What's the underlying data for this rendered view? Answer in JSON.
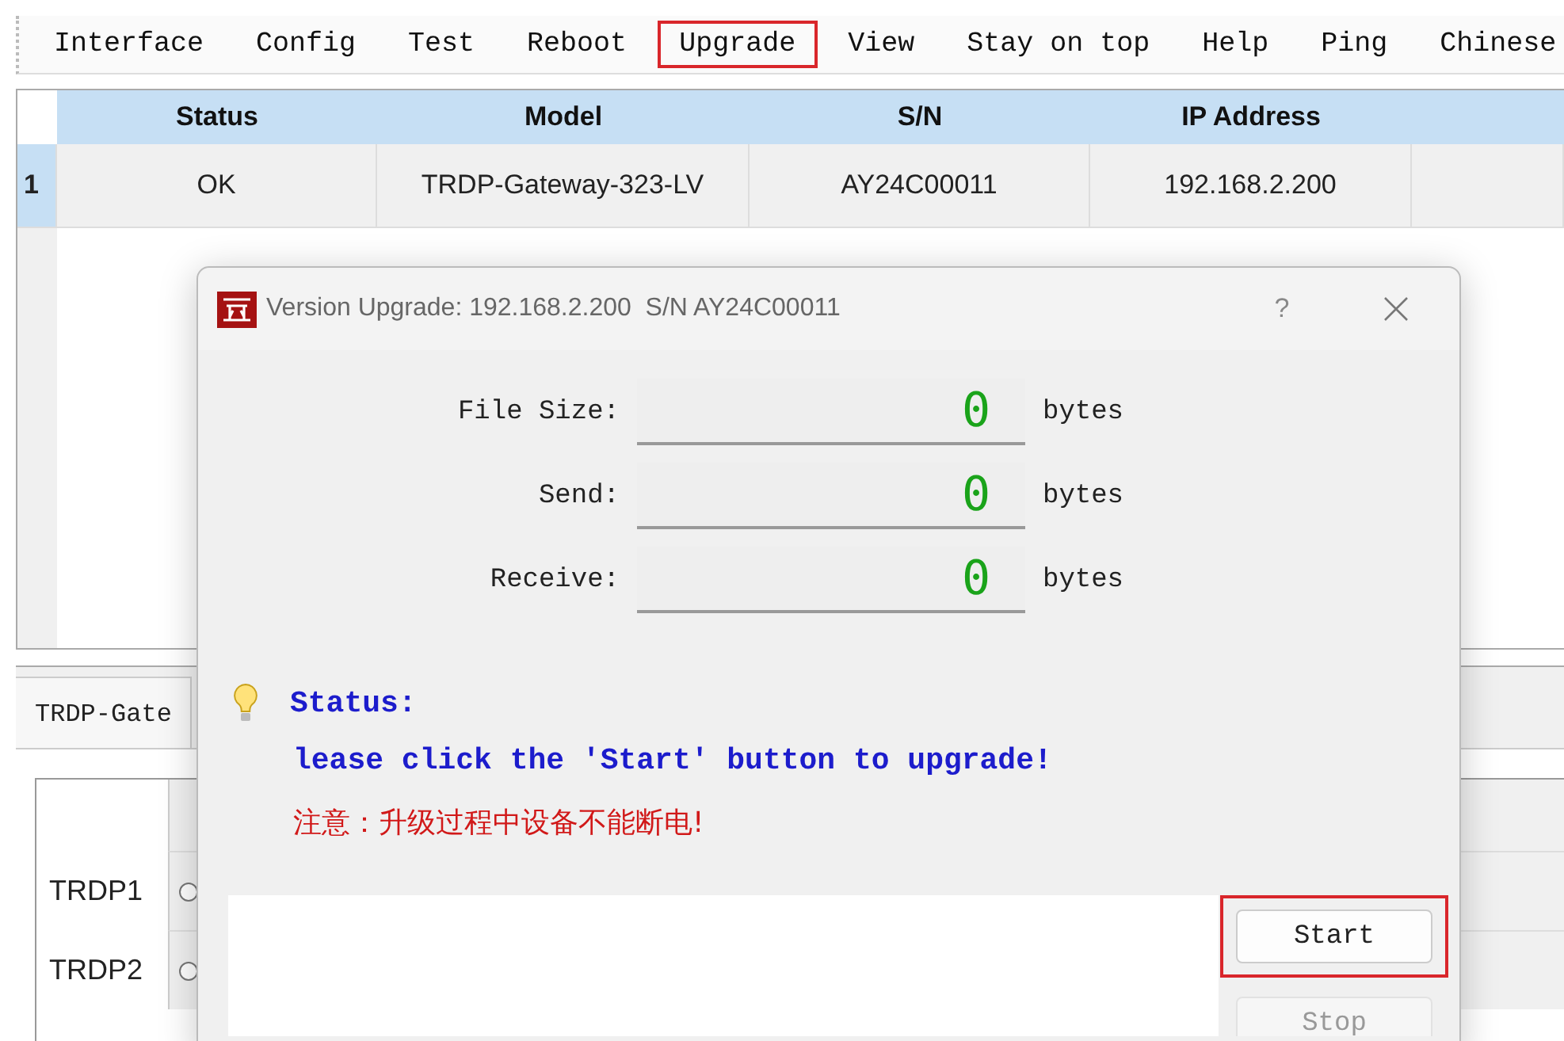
{
  "menu": [
    {
      "label": "Interface",
      "highlighted": false
    },
    {
      "label": "Config",
      "highlighted": false
    },
    {
      "label": "Test",
      "highlighted": false
    },
    {
      "label": "Reboot",
      "highlighted": false
    },
    {
      "label": "Upgrade",
      "highlighted": true
    },
    {
      "label": "View",
      "highlighted": false
    },
    {
      "label": "Stay on top",
      "highlighted": false
    },
    {
      "label": "Help",
      "highlighted": false
    },
    {
      "label": "Ping",
      "highlighted": false
    },
    {
      "label": "Chinese",
      "highlighted": false
    }
  ],
  "device_table": {
    "columns": [
      "Status",
      "Model",
      "S/N",
      "IP Address"
    ],
    "rows": [
      {
        "index": "1",
        "cells": [
          "OK",
          "TRDP-Gateway-323-LV",
          "AY24C00011",
          "192.168.2.200"
        ]
      }
    ]
  },
  "lower_panel": {
    "tab": "TRDP-Gate",
    "rows": [
      {
        "label": "TRDP1",
        "checked": false
      },
      {
        "label": "TRDP2",
        "checked": false
      }
    ]
  },
  "dialog": {
    "title": "Version Upgrade: 192.168.2.200  S/N AY24C00011",
    "help": "?",
    "counters": [
      {
        "label": "File Size:",
        "value": "0",
        "unit": "bytes"
      },
      {
        "label": "Send:",
        "value": "0",
        "unit": "bytes"
      },
      {
        "label": "Receive:",
        "value": "0",
        "unit": "bytes"
      }
    ],
    "status_label": "Status:",
    "message": "lease click the 'Start' button to upgrade!",
    "warning": "注意：升级过程中设备不能断电!",
    "buttons": [
      {
        "label": "Start",
        "disabled": false,
        "highlighted": true
      },
      {
        "label": "Stop",
        "disabled": true,
        "highlighted": false
      }
    ]
  }
}
